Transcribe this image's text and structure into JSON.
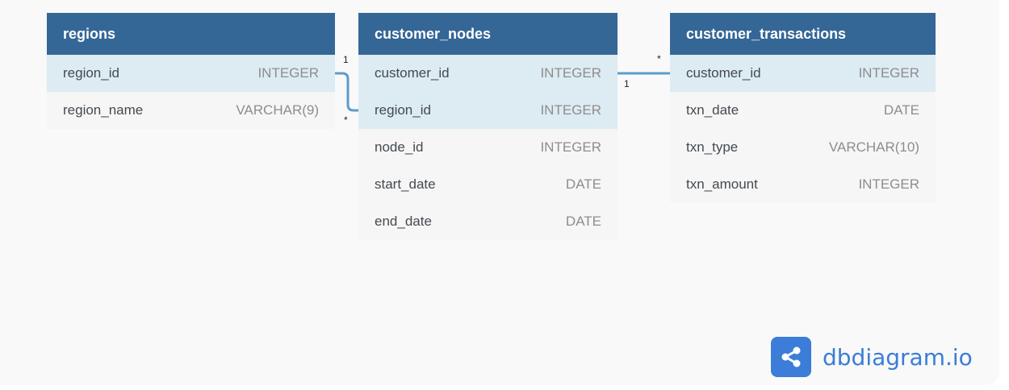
{
  "tables": {
    "regions": {
      "title": "regions",
      "columns": [
        {
          "name": "region_id",
          "type": "INTEGER"
        },
        {
          "name": "region_name",
          "type": "VARCHAR(9)"
        }
      ]
    },
    "customer_nodes": {
      "title": "customer_nodes",
      "columns": [
        {
          "name": "customer_id",
          "type": "INTEGER"
        },
        {
          "name": "region_id",
          "type": "INTEGER"
        },
        {
          "name": "node_id",
          "type": "INTEGER"
        },
        {
          "name": "start_date",
          "type": "DATE"
        },
        {
          "name": "end_date",
          "type": "DATE"
        }
      ]
    },
    "customer_transactions": {
      "title": "customer_transactions",
      "columns": [
        {
          "name": "customer_id",
          "type": "INTEGER"
        },
        {
          "name": "txn_date",
          "type": "DATE"
        },
        {
          "name": "txn_type",
          "type": "VARCHAR(10)"
        },
        {
          "name": "txn_amount",
          "type": "INTEGER"
        }
      ]
    }
  },
  "relationships": [
    {
      "from": "regions.region_id",
      "to": "customer_nodes.region_id",
      "from_card": "1",
      "to_card": "*"
    },
    {
      "from": "customer_nodes.customer_id",
      "to": "customer_transactions.customer_id",
      "from_card": "1",
      "to_card": "*"
    }
  ],
  "colors": {
    "header": "#356796",
    "highlight_row": "#ddebf2",
    "connector": "#5d9ccb",
    "brand": "#3b7dd8"
  },
  "logo": {
    "text": "dbdiagram.io",
    "icon": "share-icon"
  }
}
